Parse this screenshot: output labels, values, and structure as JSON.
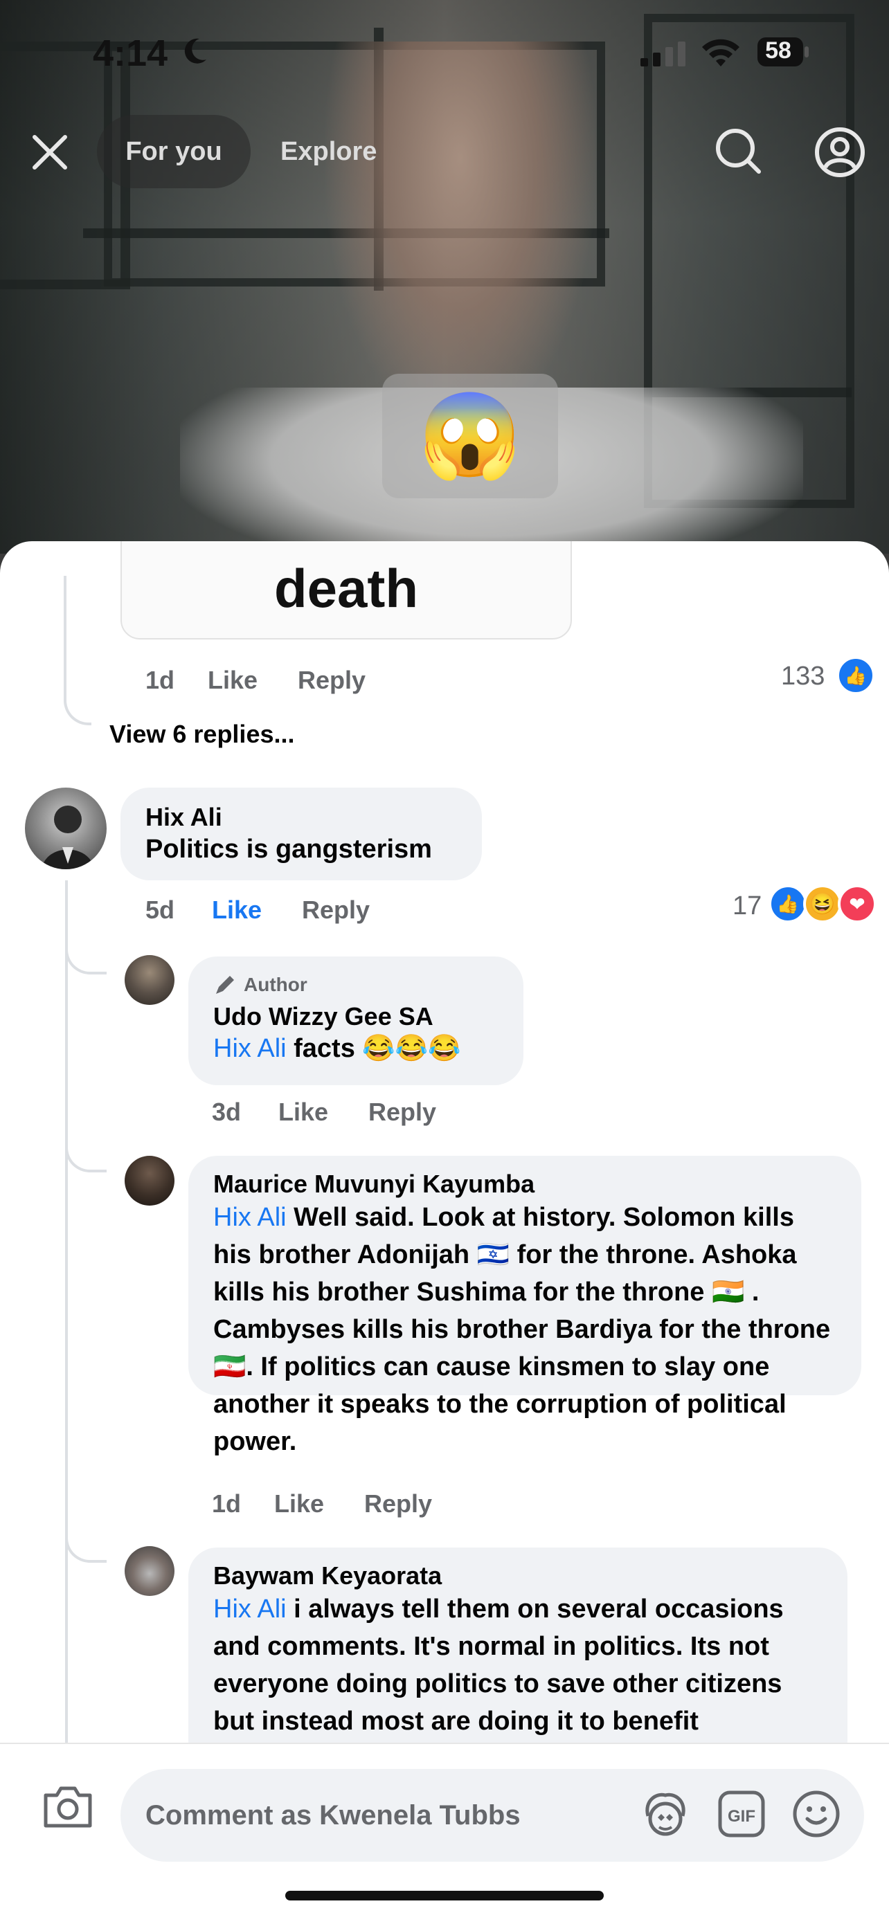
{
  "status_bar": {
    "time": "4:14",
    "battery": "58"
  },
  "top_nav": {
    "tabs": [
      "For you",
      "Explore"
    ],
    "active_tab": "For you"
  },
  "video": {
    "reaction_emoji": "😱"
  },
  "comments": {
    "first": {
      "meme_text": "death",
      "time": "1d",
      "like": "Like",
      "reply": "Reply",
      "count": "133",
      "view_replies": "View 6 replies..."
    },
    "hix": {
      "name": "Hix Ali",
      "text": "Politics is  gangsterism",
      "time": "5d",
      "like": "Like",
      "reply": "Reply",
      "count": "17",
      "reactions": [
        "👍",
        "😆",
        "❤"
      ]
    },
    "replies": [
      {
        "badge": "Author",
        "name": "Udo Wizzy Gee SA",
        "mention": "Hix Ali",
        "text": " facts 😂😂😂",
        "time": "3d",
        "like": "Like",
        "reply": "Reply"
      },
      {
        "name": "Maurice Muvunyi Kayumba",
        "mention": "Hix Ali",
        "text": " Well said. Look at history. Solomon kills his brother Adonijah 🇮🇱 for the throne. Ashoka kills his brother Sushima for the throne 🇮🇳 . Cambyses kills his brother Bardiya for the throne 🇮🇷. If politics can cause kinsmen to slay one another it speaks to the corruption of political power.",
        "time": "1d",
        "like": "Like",
        "reply": "Reply"
      },
      {
        "name": "Baywam Keyaorata",
        "mention": "Hix Ali",
        "text": " i always tell them on several occasions and comments. It's normal in politics. Its not everyone doing politics to save other citizens but instead most are doing it to benefit"
      }
    ]
  },
  "composer": {
    "placeholder": "Comment as Kwenela Tubbs"
  },
  "colors": {
    "accent": "#1877f2",
    "bubble": "#f0f2f5",
    "muted": "#65676b",
    "love": "#f33e58",
    "haha": "#f7b125"
  }
}
